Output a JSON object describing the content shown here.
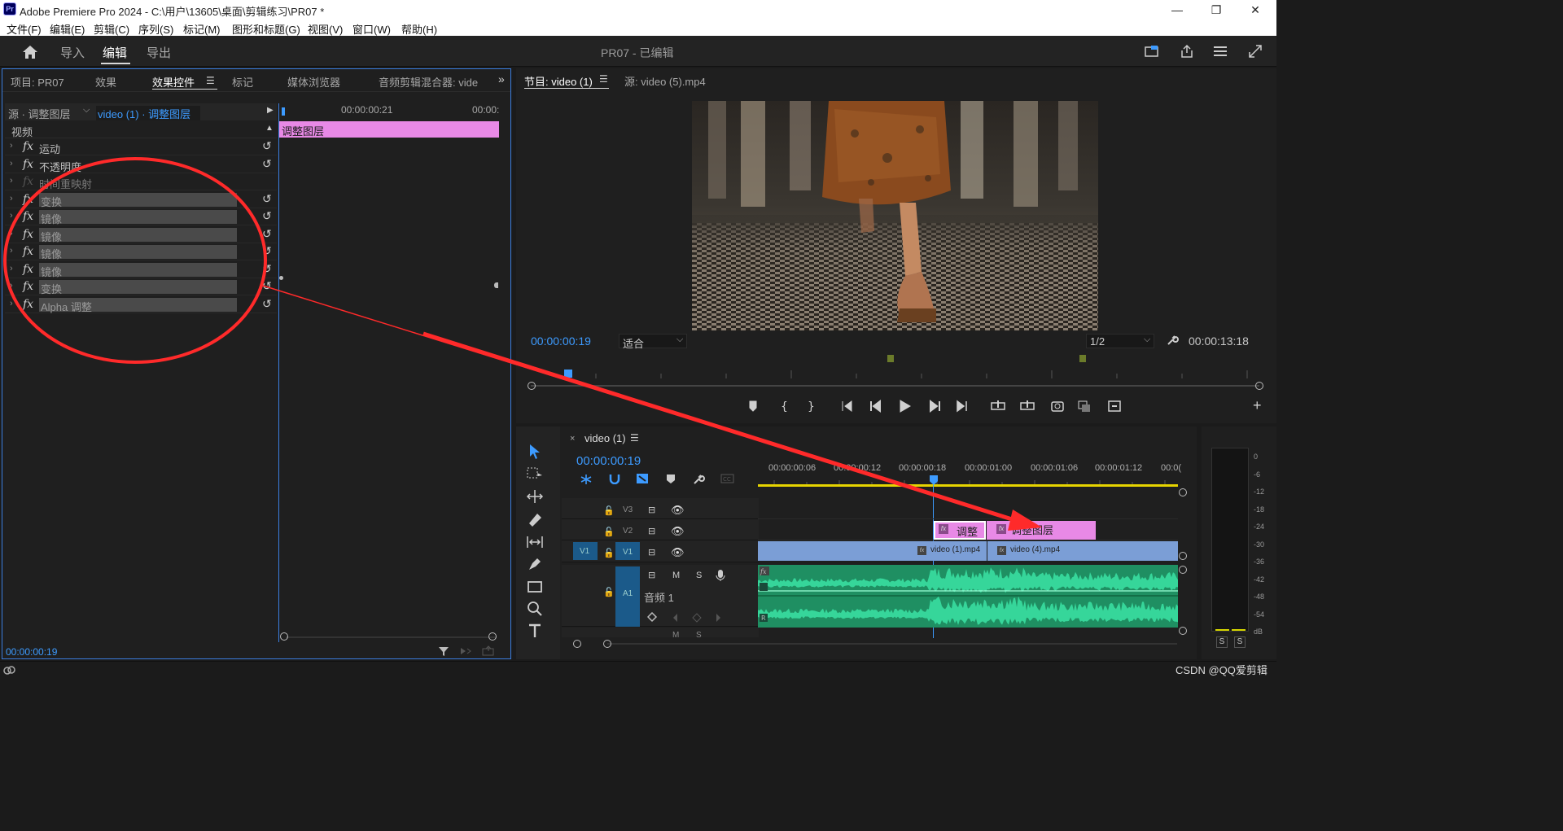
{
  "window": {
    "title": "Adobe Premiere Pro 2024 - C:\\用户\\13605\\桌面\\剪辑练习\\PR07 *",
    "app_badge": "Pr",
    "minimize": "—",
    "maximize": "❐",
    "close": "✕"
  },
  "menu": [
    "文件(F)",
    "编辑(E)",
    "剪辑(C)",
    "序列(S)",
    "标记(M)",
    "图形和标题(G)",
    "视图(V)",
    "窗口(W)",
    "帮助(H)"
  ],
  "workspace": {
    "tabs": [
      "导入",
      "编辑",
      "导出"
    ],
    "active_tab": "编辑",
    "project_title": "PR07 - 已编辑"
  },
  "left_panel": {
    "tabs": [
      "项目: PR07",
      "效果",
      "效果控件",
      "标记",
      "媒体浏览器",
      "音频剪辑混合器: vide"
    ],
    "active_tab": "效果控件",
    "source_label": "源 · 调整图层",
    "clip_label": "video (1) · 调整图层",
    "section": "视频",
    "effects": [
      {
        "name": "运动",
        "style": "plain",
        "reset": true
      },
      {
        "name": "不透明度",
        "style": "plain",
        "reset": true
      },
      {
        "name": "时间重映射",
        "style": "dim",
        "reset": false
      },
      {
        "name": "变换",
        "style": "bar",
        "reset": true
      },
      {
        "name": "镜像",
        "style": "bar",
        "reset": true
      },
      {
        "name": "镜像",
        "style": "bar",
        "reset": true
      },
      {
        "name": "镜像",
        "style": "bar",
        "reset": true
      },
      {
        "name": "镜像",
        "style": "bar",
        "reset": true
      },
      {
        "name": "变换",
        "style": "bar",
        "reset": true
      },
      {
        "name": "Alpha 调整",
        "style": "bar",
        "reset": true
      }
    ],
    "mini_timeline": {
      "tick_1": "00:00:00:21",
      "tick_2": "00:00:",
      "clip_label": "调整图层"
    },
    "timecode": "00:00:00:19"
  },
  "program_monitor": {
    "tab_program": "节目: video (1)",
    "tab_source": "源: video (5).mp4",
    "timecode": "00:00:00:19",
    "fit": "适合",
    "resolution": "1/2",
    "duration": "00:00:13:18"
  },
  "timeline": {
    "sequence_name": "video (1)",
    "timecode": "00:00:00:19",
    "ruler": [
      "00:00:00:06",
      "00:00:00:12",
      "00:00:00:18",
      "00:00:01:00",
      "00:00:01:06",
      "00:00:01:12",
      "00:0("
    ],
    "tracks": {
      "v3": "V3",
      "v2": "V2",
      "v1": "V1",
      "v1_src": "V1",
      "a1": "A1",
      "a1_name": "音频 1",
      "mute": "M",
      "solo": "S"
    },
    "clips": {
      "adj_short": "调整",
      "adj_long": "调整图层",
      "video1": "video (1).mp4",
      "video4": "video (4).mp4",
      "fx_badge": "fx"
    }
  },
  "audio_meter": {
    "scale": [
      "0",
      "-6",
      "-12",
      "-18",
      "-24",
      "-30",
      "-36",
      "-42",
      "-48",
      "-54",
      "dB"
    ],
    "solo_left": "S",
    "solo_right": "S"
  },
  "watermark": "CSDN @QQ爱剪辑",
  "colors": {
    "accent_blue": "#3d9bff",
    "adjustment_layer": "#e889e6",
    "video_clip": "#7b9ed6",
    "audio_clip": "#1f8f62",
    "annotation_red": "#ff2a2a"
  }
}
